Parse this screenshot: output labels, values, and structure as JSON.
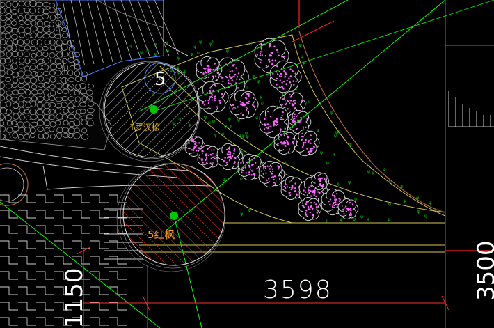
{
  "drawing": {
    "background_color": "#000000",
    "plants": {
      "pine": {
        "label": "1罗汉松",
        "color": "#e6b400",
        "hatch_color": "#c8c8c8"
      },
      "maple": {
        "label": "5红枫",
        "color": "#ff3030",
        "hatch_color": "#ff3030"
      },
      "shrub_color": "#ff66ff",
      "groundcover_color": "#00c800"
    },
    "bubble_tag": {
      "text": "5",
      "color": "#4a8cff"
    },
    "dimensions": {
      "horizontal": "3598",
      "vertical_left": "1150",
      "vertical_right": "3500",
      "line_color": "#ff3030",
      "text_color": "#ffffff"
    },
    "colors": {
      "boundary": "#d4c850",
      "guide_line": "#00ff00",
      "paving": "#d8d8d8",
      "pebble": "#a0a0a0",
      "edge_brown": "#b06a3a",
      "wall": "#ff2020"
    }
  }
}
